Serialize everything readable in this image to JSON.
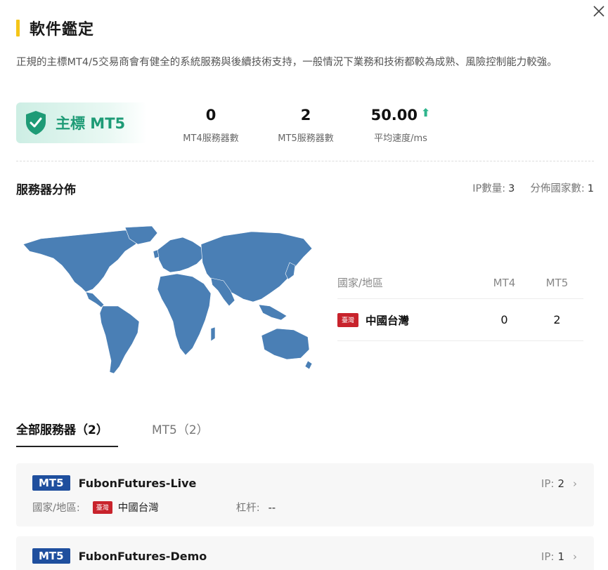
{
  "header": {
    "title": "軟件鑑定",
    "close_icon": "close-icon"
  },
  "description": "正規的主標MT4/5交易商會有健全的系統服務與後續技術支持，一般情況下業務和技術都較為成熟、風險控制能力較強。",
  "badge": {
    "label": "主標 MT5",
    "icon": "shield-check-icon",
    "color": "#1e9b76"
  },
  "stats": [
    {
      "value": "0",
      "label": "MT4服務器數"
    },
    {
      "value": "2",
      "label": "MT5服務器數"
    },
    {
      "value": "50.00",
      "label": "平均速度/ms",
      "indicator": "arrow-up-icon"
    }
  ],
  "distribution": {
    "title": "服務器分佈",
    "ip_label": "IP數量:",
    "ip_count": "3",
    "country_label": "分佈國家數:",
    "country_count": "1",
    "table": {
      "headers": [
        "國家/地區",
        "MT4",
        "MT5"
      ],
      "rows": [
        {
          "flag": "臺灣",
          "region": "中國台灣",
          "mt4": "0",
          "mt5": "2"
        }
      ]
    }
  },
  "tabs": [
    {
      "label": "全部服務器（2）",
      "active": true
    },
    {
      "label": "MT5（2）",
      "active": false
    }
  ],
  "servers": [
    {
      "tag": "MT5",
      "name": "FubonFutures-Live",
      "ip_label": "IP:",
      "ip_count": "2",
      "region_label": "國家/地區:",
      "flag": "臺灣",
      "region": "中國台灣",
      "leverage_label": "杠杆:",
      "leverage": "--"
    },
    {
      "tag": "MT5",
      "name": "FubonFutures-Demo",
      "ip_label": "IP:",
      "ip_count": "1"
    }
  ],
  "colors": {
    "accent": "#f5c518",
    "brand_green": "#1e9b76",
    "mt5_tag": "#1f4f9e",
    "map_land": "#4a7fb5",
    "flag_red": "#c8232c"
  }
}
